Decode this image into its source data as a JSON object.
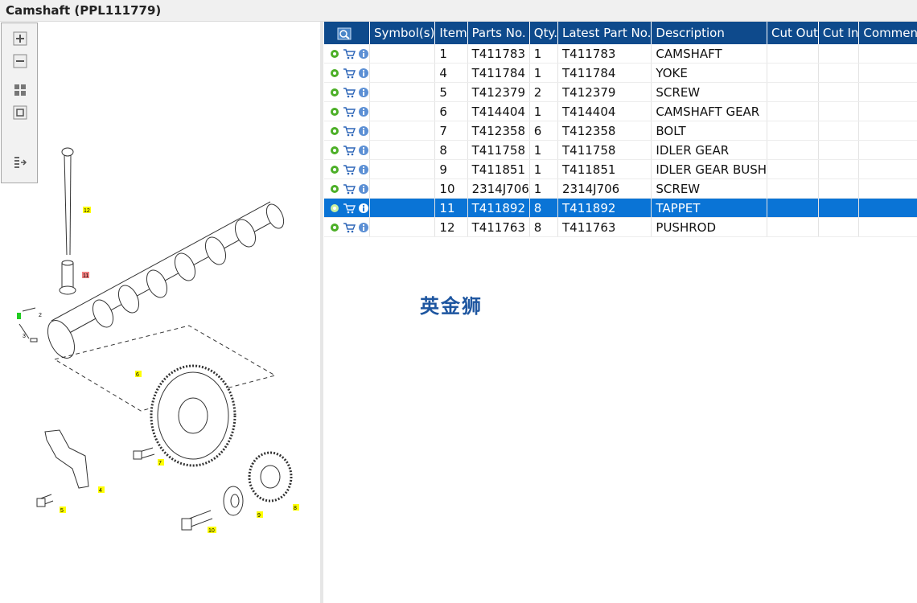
{
  "window": {
    "title": "Camshaft (PPL111779)"
  },
  "toolbar": {
    "buttons": [
      {
        "icon": "zoom-in-icon"
      },
      {
        "icon": "zoom-out-icon"
      },
      {
        "icon": "fit-page-icon"
      },
      {
        "icon": "actual-size-icon"
      },
      {
        "icon": "export-list-icon"
      }
    ]
  },
  "diagram": {
    "callouts": [
      "1",
      "2",
      "3",
      "4",
      "5",
      "6",
      "7",
      "8",
      "9",
      "10",
      "11",
      "12"
    ],
    "highlighted": "11",
    "selected": "1"
  },
  "table": {
    "columns": [
      "",
      "Symbol(s)",
      "Item",
      "Parts No.",
      "Qty.",
      "Latest Part No.",
      "Description",
      "Cut Out",
      "Cut In",
      "Comment"
    ],
    "rows": [
      {
        "item": "1",
        "part": "T411783",
        "qty": "1",
        "latest": "T411783",
        "desc": "CAMSHAFT",
        "selected": false
      },
      {
        "item": "4",
        "part": "T411784",
        "qty": "1",
        "latest": "T411784",
        "desc": "YOKE",
        "selected": false
      },
      {
        "item": "5",
        "part": "T412379",
        "qty": "2",
        "latest": "T412379",
        "desc": "SCREW",
        "selected": false
      },
      {
        "item": "6",
        "part": "T414404",
        "qty": "1",
        "latest": "T414404",
        "desc": "CAMSHAFT GEAR",
        "selected": false
      },
      {
        "item": "7",
        "part": "T412358",
        "qty": "6",
        "latest": "T412358",
        "desc": "BOLT",
        "selected": false
      },
      {
        "item": "8",
        "part": "T411758",
        "qty": "1",
        "latest": "T411758",
        "desc": "IDLER GEAR",
        "selected": false
      },
      {
        "item": "9",
        "part": "T411851",
        "qty": "1",
        "latest": "T411851",
        "desc": "IDLER GEAR BUSH",
        "selected": false
      },
      {
        "item": "10",
        "part": "2314J706",
        "qty": "1",
        "latest": "2314J706",
        "desc": "SCREW",
        "selected": false
      },
      {
        "item": "11",
        "part": "T411892",
        "qty": "8",
        "latest": "T411892",
        "desc": "TAPPET",
        "selected": true
      },
      {
        "item": "12",
        "part": "T411763",
        "qty": "8",
        "latest": "T411763",
        "desc": "PUSHROD",
        "selected": false
      }
    ]
  },
  "watermark": "英金狮",
  "colors": {
    "header": "#0e4a8c",
    "selected": "#0a74d6",
    "callout": "#ffff00",
    "callout_highlight": "#f08080",
    "callout_selected": "#22cc22"
  }
}
